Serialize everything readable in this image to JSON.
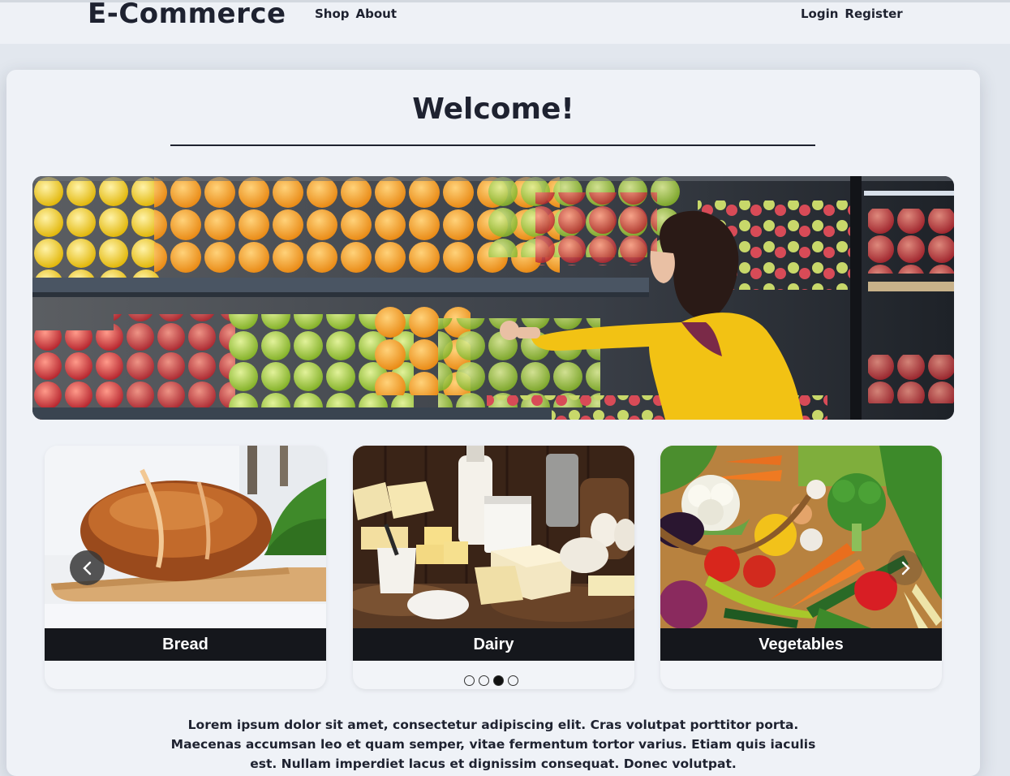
{
  "header": {
    "brand": "E-Commerce",
    "nav_left": [
      "Shop",
      "About"
    ],
    "nav_right": [
      "Login",
      "Register"
    ]
  },
  "main": {
    "title": "Welcome!",
    "carousel": {
      "slides": [
        {
          "caption": "Bread"
        },
        {
          "caption": "Dairy"
        },
        {
          "caption": "Vegetables"
        }
      ],
      "dot_count": 4,
      "active_dot": 3
    },
    "intro_text": "Lorem ipsum dolor sit amet, consectetur adipiscing elit. Cras volutpat porttitor porta. Maecenas accumsan leo et quam semper, vitae fermentum tortor varius. Etiam quis iaculis est. Nullam imperdiet lacus et dignissim consequat. Donec volutpat."
  },
  "colors": {
    "page_bg": "#e2e7ee",
    "card_bg": "#eff2f7",
    "text": "#1e2230",
    "caption_bg": "#15171c",
    "caption_text": "#ffffff"
  },
  "icons": {
    "prev": "chevron-left-icon",
    "next": "chevron-right-icon"
  }
}
